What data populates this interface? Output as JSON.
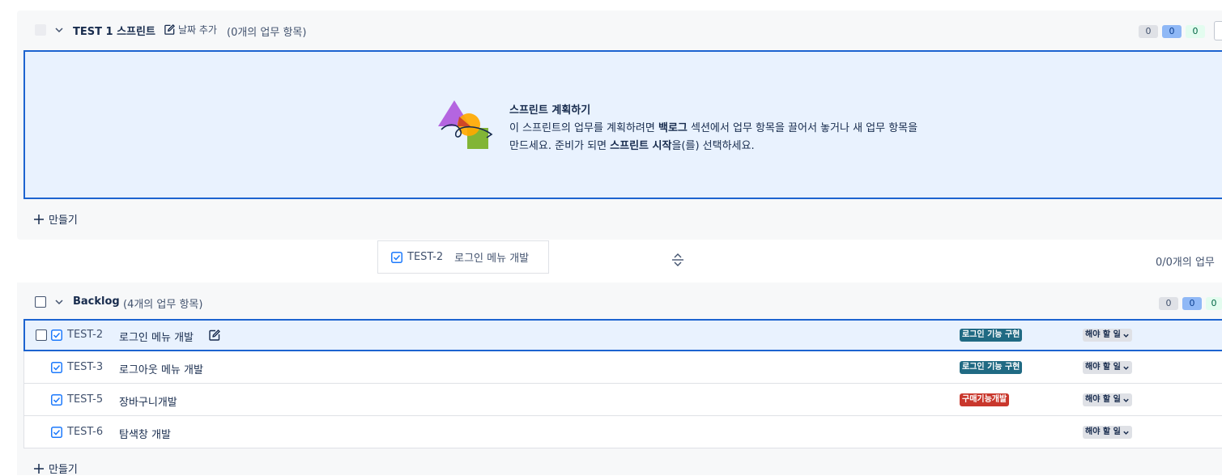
{
  "sprint": {
    "title": "TEST 1 스프린트",
    "add_date_label": "날짜 추가",
    "count_label": "(0개의 업무 항목)",
    "badges": [
      "0",
      "0",
      "0"
    ],
    "empty_state": {
      "title": "스프린트 계획하기",
      "desc_part1": "이 스프린트의 업무를 계획하려면 ",
      "desc_bold1": "백로그",
      "desc_part2": " 섹션에서 업무 항목을 끌어서 놓거나 새 업무 항목을 만드세요. 준비가 되면 ",
      "desc_bold2": "스프린트 시작",
      "desc_part3": "을(를) 선택하세요."
    },
    "create_label": "만들기"
  },
  "drag_ghost": {
    "key": "TEST-2",
    "summary": "로그인 메뉴 개발"
  },
  "progress_label": "0/0개의 업무",
  "backlog": {
    "title": "Backlog",
    "count_label": "(4개의 업무 항목)",
    "badges": [
      "0",
      "0",
      "0"
    ],
    "create_label": "만들기",
    "issues": [
      {
        "key": "TEST-2",
        "summary": "로그인 메뉴 개발",
        "epic": "로그인 기능 구현",
        "epic_color": "#206a83",
        "status": "해야 할 일",
        "selected": true
      },
      {
        "key": "TEST-3",
        "summary": "로그아웃 메뉴 개발",
        "epic": "로그인 기능 구현",
        "epic_color": "#206a83",
        "status": "해야 할 일",
        "selected": false
      },
      {
        "key": "TEST-5",
        "summary": "장바구니개발",
        "epic": "구매기능개발",
        "epic_color": "#c9372c",
        "status": "해야 할 일",
        "selected": false
      },
      {
        "key": "TEST-6",
        "summary": "탐색창 개발",
        "epic": "",
        "epic_color": "",
        "status": "해야 할 일",
        "selected": false
      }
    ]
  },
  "colors": {
    "accent": "#1d64d0",
    "highlight_bg": "#e9f2fe",
    "panel_bg": "#f7f8f9"
  }
}
